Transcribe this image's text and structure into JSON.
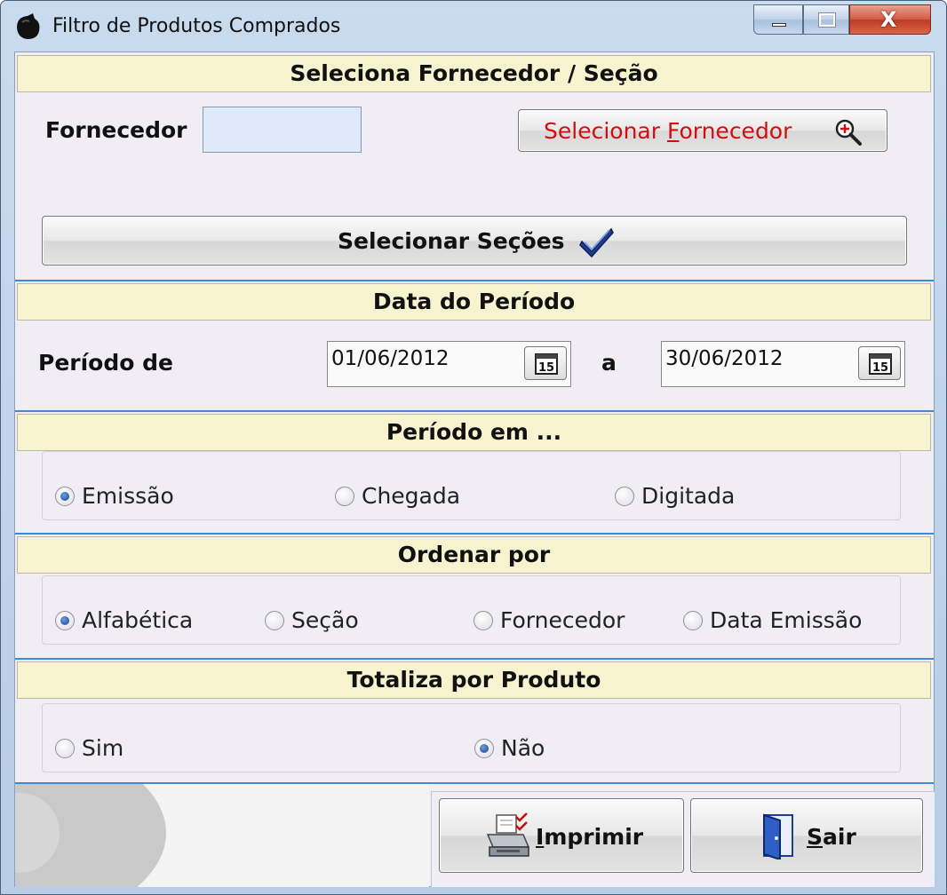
{
  "window": {
    "title": "Filtro de Produtos Comprados",
    "close_glyph": "X"
  },
  "sections": {
    "fornecedor_secao": "Seleciona Fornecedor / Seção",
    "data_periodo": "Data do Período",
    "periodo_em": "Período em ...",
    "ordenar_por": "Ordenar por",
    "totaliza": "Totaliza por Produto"
  },
  "fornecedor": {
    "label": "Fornecedor",
    "value": "",
    "select_button": {
      "before": "Selecionar ",
      "hotkey": "F",
      "after": "ornecedor",
      "icon": "zoom-in-icon"
    }
  },
  "secoes_button": {
    "label": "Selecionar Seções",
    "icon": "checkmark-icon"
  },
  "periodo": {
    "label": "Período de",
    "separator": "a",
    "from": "01/06/2012",
    "to": "30/06/2012",
    "calendar_day": "15"
  },
  "periodo_em": {
    "options": [
      "Emissão",
      "Chegada",
      "Digitada"
    ],
    "selected": "Emissão"
  },
  "ordenar": {
    "options": [
      "Alfabética",
      "Seção",
      "Fornecedor",
      "Data Emissão"
    ],
    "selected": "Alfabética"
  },
  "totaliza": {
    "options": [
      "Sim",
      "Não"
    ],
    "selected": "Não"
  },
  "actions": {
    "imprimir": {
      "hotkey": "I",
      "rest": "mprimir",
      "icon": "printer-icon"
    },
    "sair": {
      "hotkey": "S",
      "rest": "air",
      "icon": "exit-door-icon"
    }
  },
  "colors": {
    "header_bg": "#f7f3cf",
    "separator_blue": "#3c8ad8",
    "fornecedor_button_text": "#d01010",
    "input_bg": "#dfeaf8"
  }
}
